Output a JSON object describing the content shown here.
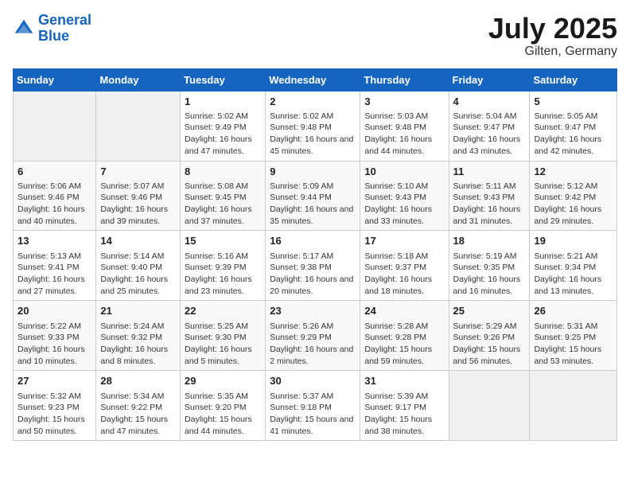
{
  "header": {
    "logo_line1": "General",
    "logo_line2": "Blue",
    "month": "July 2025",
    "location": "Gilten, Germany"
  },
  "weekdays": [
    "Sunday",
    "Monday",
    "Tuesday",
    "Wednesday",
    "Thursday",
    "Friday",
    "Saturday"
  ],
  "weeks": [
    [
      {
        "day": "",
        "info": ""
      },
      {
        "day": "",
        "info": ""
      },
      {
        "day": "1",
        "info": "Sunrise: 5:02 AM\nSunset: 9:49 PM\nDaylight: 16 hours and 47 minutes."
      },
      {
        "day": "2",
        "info": "Sunrise: 5:02 AM\nSunset: 9:48 PM\nDaylight: 16 hours and 45 minutes."
      },
      {
        "day": "3",
        "info": "Sunrise: 5:03 AM\nSunset: 9:48 PM\nDaylight: 16 hours and 44 minutes."
      },
      {
        "day": "4",
        "info": "Sunrise: 5:04 AM\nSunset: 9:47 PM\nDaylight: 16 hours and 43 minutes."
      },
      {
        "day": "5",
        "info": "Sunrise: 5:05 AM\nSunset: 9:47 PM\nDaylight: 16 hours and 42 minutes."
      }
    ],
    [
      {
        "day": "6",
        "info": "Sunrise: 5:06 AM\nSunset: 9:46 PM\nDaylight: 16 hours and 40 minutes."
      },
      {
        "day": "7",
        "info": "Sunrise: 5:07 AM\nSunset: 9:46 PM\nDaylight: 16 hours and 39 minutes."
      },
      {
        "day": "8",
        "info": "Sunrise: 5:08 AM\nSunset: 9:45 PM\nDaylight: 16 hours and 37 minutes."
      },
      {
        "day": "9",
        "info": "Sunrise: 5:09 AM\nSunset: 9:44 PM\nDaylight: 16 hours and 35 minutes."
      },
      {
        "day": "10",
        "info": "Sunrise: 5:10 AM\nSunset: 9:43 PM\nDaylight: 16 hours and 33 minutes."
      },
      {
        "day": "11",
        "info": "Sunrise: 5:11 AM\nSunset: 9:43 PM\nDaylight: 16 hours and 31 minutes."
      },
      {
        "day": "12",
        "info": "Sunrise: 5:12 AM\nSunset: 9:42 PM\nDaylight: 16 hours and 29 minutes."
      }
    ],
    [
      {
        "day": "13",
        "info": "Sunrise: 5:13 AM\nSunset: 9:41 PM\nDaylight: 16 hours and 27 minutes."
      },
      {
        "day": "14",
        "info": "Sunrise: 5:14 AM\nSunset: 9:40 PM\nDaylight: 16 hours and 25 minutes."
      },
      {
        "day": "15",
        "info": "Sunrise: 5:16 AM\nSunset: 9:39 PM\nDaylight: 16 hours and 23 minutes."
      },
      {
        "day": "16",
        "info": "Sunrise: 5:17 AM\nSunset: 9:38 PM\nDaylight: 16 hours and 20 minutes."
      },
      {
        "day": "17",
        "info": "Sunrise: 5:18 AM\nSunset: 9:37 PM\nDaylight: 16 hours and 18 minutes."
      },
      {
        "day": "18",
        "info": "Sunrise: 5:19 AM\nSunset: 9:35 PM\nDaylight: 16 hours and 16 minutes."
      },
      {
        "day": "19",
        "info": "Sunrise: 5:21 AM\nSunset: 9:34 PM\nDaylight: 16 hours and 13 minutes."
      }
    ],
    [
      {
        "day": "20",
        "info": "Sunrise: 5:22 AM\nSunset: 9:33 PM\nDaylight: 16 hours and 10 minutes."
      },
      {
        "day": "21",
        "info": "Sunrise: 5:24 AM\nSunset: 9:32 PM\nDaylight: 16 hours and 8 minutes."
      },
      {
        "day": "22",
        "info": "Sunrise: 5:25 AM\nSunset: 9:30 PM\nDaylight: 16 hours and 5 minutes."
      },
      {
        "day": "23",
        "info": "Sunrise: 5:26 AM\nSunset: 9:29 PM\nDaylight: 16 hours and 2 minutes."
      },
      {
        "day": "24",
        "info": "Sunrise: 5:28 AM\nSunset: 9:28 PM\nDaylight: 15 hours and 59 minutes."
      },
      {
        "day": "25",
        "info": "Sunrise: 5:29 AM\nSunset: 9:26 PM\nDaylight: 15 hours and 56 minutes."
      },
      {
        "day": "26",
        "info": "Sunrise: 5:31 AM\nSunset: 9:25 PM\nDaylight: 15 hours and 53 minutes."
      }
    ],
    [
      {
        "day": "27",
        "info": "Sunrise: 5:32 AM\nSunset: 9:23 PM\nDaylight: 15 hours and 50 minutes."
      },
      {
        "day": "28",
        "info": "Sunrise: 5:34 AM\nSunset: 9:22 PM\nDaylight: 15 hours and 47 minutes."
      },
      {
        "day": "29",
        "info": "Sunrise: 5:35 AM\nSunset: 9:20 PM\nDaylight: 15 hours and 44 minutes."
      },
      {
        "day": "30",
        "info": "Sunrise: 5:37 AM\nSunset: 9:18 PM\nDaylight: 15 hours and 41 minutes."
      },
      {
        "day": "31",
        "info": "Sunrise: 5:39 AM\nSunset: 9:17 PM\nDaylight: 15 hours and 38 minutes."
      },
      {
        "day": "",
        "info": ""
      },
      {
        "day": "",
        "info": ""
      }
    ]
  ]
}
